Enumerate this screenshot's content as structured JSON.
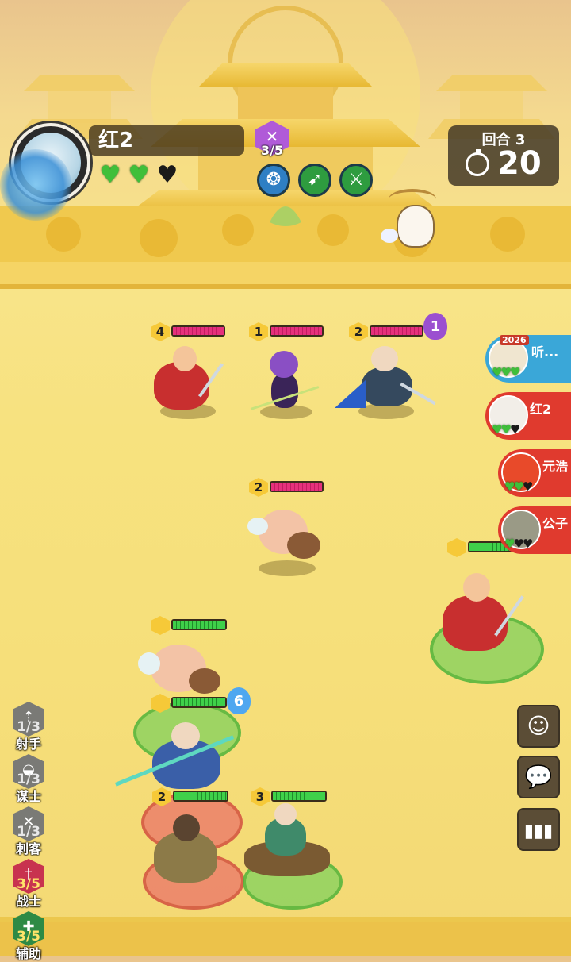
{
  "player": {
    "name": "红2",
    "hearts": [
      "full",
      "full",
      "empty"
    ],
    "class_count": "3/5"
  },
  "round": {
    "label": "回合 3",
    "timer": "20"
  },
  "enemy_units": [
    {
      "star": "4",
      "hp": 1.0
    },
    {
      "star": "1",
      "hp": 1.0
    },
    {
      "star": "2",
      "hp": 1.0,
      "mana": "1"
    },
    {
      "star": "2",
      "hp": 1.0
    }
  ],
  "ally_units": [
    {
      "star": "",
      "hp": 1.0
    },
    {
      "star": "",
      "hp": 1.0
    },
    {
      "star": "",
      "hp": 1.0,
      "mana": "6"
    },
    {
      "star": "2",
      "hp": 1.0
    },
    {
      "star": "3",
      "hp": 1.0
    }
  ],
  "players": [
    {
      "name": "听...",
      "badge": "2026",
      "hearts": [
        "full",
        "full",
        "full"
      ],
      "color": "#3aa7d8"
    },
    {
      "name": "红2",
      "hearts": [
        "full",
        "full",
        "empty"
      ],
      "color": "#e03a2e"
    },
    {
      "name": "元浩",
      "hearts": [
        "full",
        "full",
        "empty"
      ],
      "color": "#e03a2e"
    },
    {
      "name": "公子",
      "hearts": [
        "full",
        "empty",
        "empty"
      ],
      "color": "#e03a2e"
    }
  ],
  "classes": [
    {
      "name": "射手",
      "count": "1/3",
      "active": false
    },
    {
      "name": "谋士",
      "count": "1/3",
      "active": false
    },
    {
      "name": "刺客",
      "count": "1/3",
      "active": false
    },
    {
      "name": "战士",
      "count": "3/5",
      "active": true,
      "color": "#c8334f"
    },
    {
      "name": "辅助",
      "count": "3/5",
      "active": true,
      "color": "#2e8a45"
    }
  ],
  "buttons": {
    "emote": "emote-icon",
    "chat": "chat-icon",
    "stats": "stats-icon"
  },
  "colors": {
    "heart_full": "#3fbf3a",
    "enemy_hp": "#e6307c",
    "ally_hp": "#3fd04a"
  }
}
